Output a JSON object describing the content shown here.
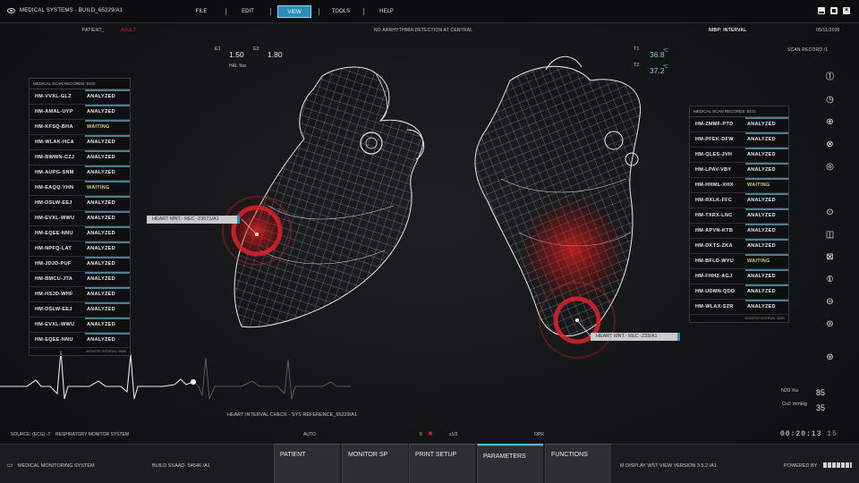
{
  "app": {
    "title": "MEDICAL SYSTEMS - BUILD_65229/A1"
  },
  "menu": [
    {
      "label": "FILE"
    },
    {
      "label": "EDIT"
    },
    {
      "label": "VIEW"
    },
    {
      "label": "TOOLS"
    },
    {
      "label": "HELP"
    }
  ],
  "header": {
    "patient": "PATIENT_",
    "patient_type": "ADULT",
    "message": "NO ARRHYTHMIA DETECTION AT CENTRAL",
    "nibp": "NIBP: INTERVAL",
    "date": "05/11/2035",
    "scan_record": "SCAN RECORD /1"
  },
  "stats": {
    "e1_label": "E1",
    "e1_value": "1.50",
    "e2_label": "E2",
    "e2_value": "1.80",
    "hal": "HAL %w",
    "t1_label": "T1",
    "t1_value": "36.8",
    "t1_unit": "°C",
    "t2_label": "T2",
    "t2_value": "37.2",
    "t2_unit": "°C"
  },
  "left_panel": {
    "title": "MEDICAL SCAN RECORDS: ECG",
    "footer": "MONITOR INTERVAL: 5MIN",
    "rows": [
      {
        "id": "HM-VVXL-GLZ",
        "status": "ANALYZED"
      },
      {
        "id": "HM-AMAL-UYP",
        "status": "ANALYZED"
      },
      {
        "id": "HM-KFSQ-BHA",
        "status": "WAITING"
      },
      {
        "id": "HM-WLAK-HCA",
        "status": "ANALYZED"
      },
      {
        "id": "HM-BWWN-CZJ",
        "status": "ANALYZED"
      },
      {
        "id": "HM-AUPG-SNM",
        "status": "ANALYZED"
      },
      {
        "id": "HM-EAQQ-YHN",
        "status": "WAITING"
      },
      {
        "id": "HM-DSLW-EEJ",
        "status": "ANALYZED"
      },
      {
        "id": "HM-EVXL-WWU",
        "status": "ANALYZED"
      },
      {
        "id": "HM-EQEE-NNU",
        "status": "ANALYZED"
      },
      {
        "id": "HM-NPFQ-LAT",
        "status": "ANALYZED"
      },
      {
        "id": "HM-JDJD-PUF",
        "status": "ANALYZED"
      },
      {
        "id": "HM-BMCU-JTA",
        "status": "ANALYZED"
      },
      {
        "id": "HM-HSJD-WHF",
        "status": "ANALYZED"
      },
      {
        "id": "HM-DSLW-EEJ",
        "status": "ANALYZED"
      },
      {
        "id": "HM-EVXL-WWU",
        "status": "ANALYZED"
      },
      {
        "id": "HM-EQEE-NNU",
        "status": "ANALYZED"
      }
    ]
  },
  "right_panel": {
    "title": "MEDICAL SCAN RECORDS: ECG",
    "footer": "MONITOR INTERVAL: 5MIN",
    "rows": [
      {
        "id": "HM-ZMMF-PTD",
        "status": "ANALYZED"
      },
      {
        "id": "HM-PFEK-DFW",
        "status": "ANALYZED"
      },
      {
        "id": "HM-QLES-JVH",
        "status": "ANALYZED"
      },
      {
        "id": "HM-LPAV-VBY",
        "status": "ANALYZED"
      },
      {
        "id": "HM-HHML-XHX",
        "status": "WAITING"
      },
      {
        "id": "HM-RXLK-FFC",
        "status": "ANALYZED"
      },
      {
        "id": "HM-TXRX-LNC",
        "status": "ANALYZED"
      },
      {
        "id": "HM-APVN-KTB",
        "status": "ANALYZED"
      },
      {
        "id": "HM-DKTS-ZKA",
        "status": "ANALYZED"
      },
      {
        "id": "HM-BFLD-WYU",
        "status": "WAITING"
      },
      {
        "id": "HM-FHHZ-AGJ",
        "status": "ANALYZED"
      },
      {
        "id": "HM-UDMN-QDD",
        "status": "ANALYZED"
      },
      {
        "id": "HM-WLAX-SZR",
        "status": "ANALYZED"
      }
    ]
  },
  "callouts": {
    "left": "HEART MNT.- REC -23571/A1",
    "right": "HEART MNT.- REC -233/A1"
  },
  "ecg_caption": "HEART INTERVAL CHECK - SYS REFERENCE_65229/A1",
  "vitals": {
    "n2o_label": "N20 %v",
    "n2o_value": "85",
    "co2_label": "Co2 mmHg",
    "co2_value": "35"
  },
  "status_row": {
    "source": "SOURCE: (ECG) -T",
    "system": "RESPIRATORY MONITOR SYSTEM",
    "auto": "AUTO",
    "ii": "II",
    "ratio": "x1/2",
    "opr": "OPR",
    "clock": "00:20:13",
    "clock_frac": "15"
  },
  "bottom": {
    "system": "MEDICAL MONITORING SYSTEM",
    "build": "BUILD SSAAD- 54546  /A1",
    "version": "M DISPLAY WST VIEW  VERSION 3.5.2 /A1",
    "powered": "POWERED BY",
    "tabs": [
      {
        "label": "PATIENT"
      },
      {
        "label": "MONITOR SP"
      },
      {
        "label": "PRINT SETUP"
      },
      {
        "label": "PARAMETERS"
      },
      {
        "label": "FUNCTIONS"
      }
    ]
  },
  "colors": {
    "accent": "#2a8fb8",
    "alert": "#e0202a",
    "waiting": "#d6c97a"
  }
}
